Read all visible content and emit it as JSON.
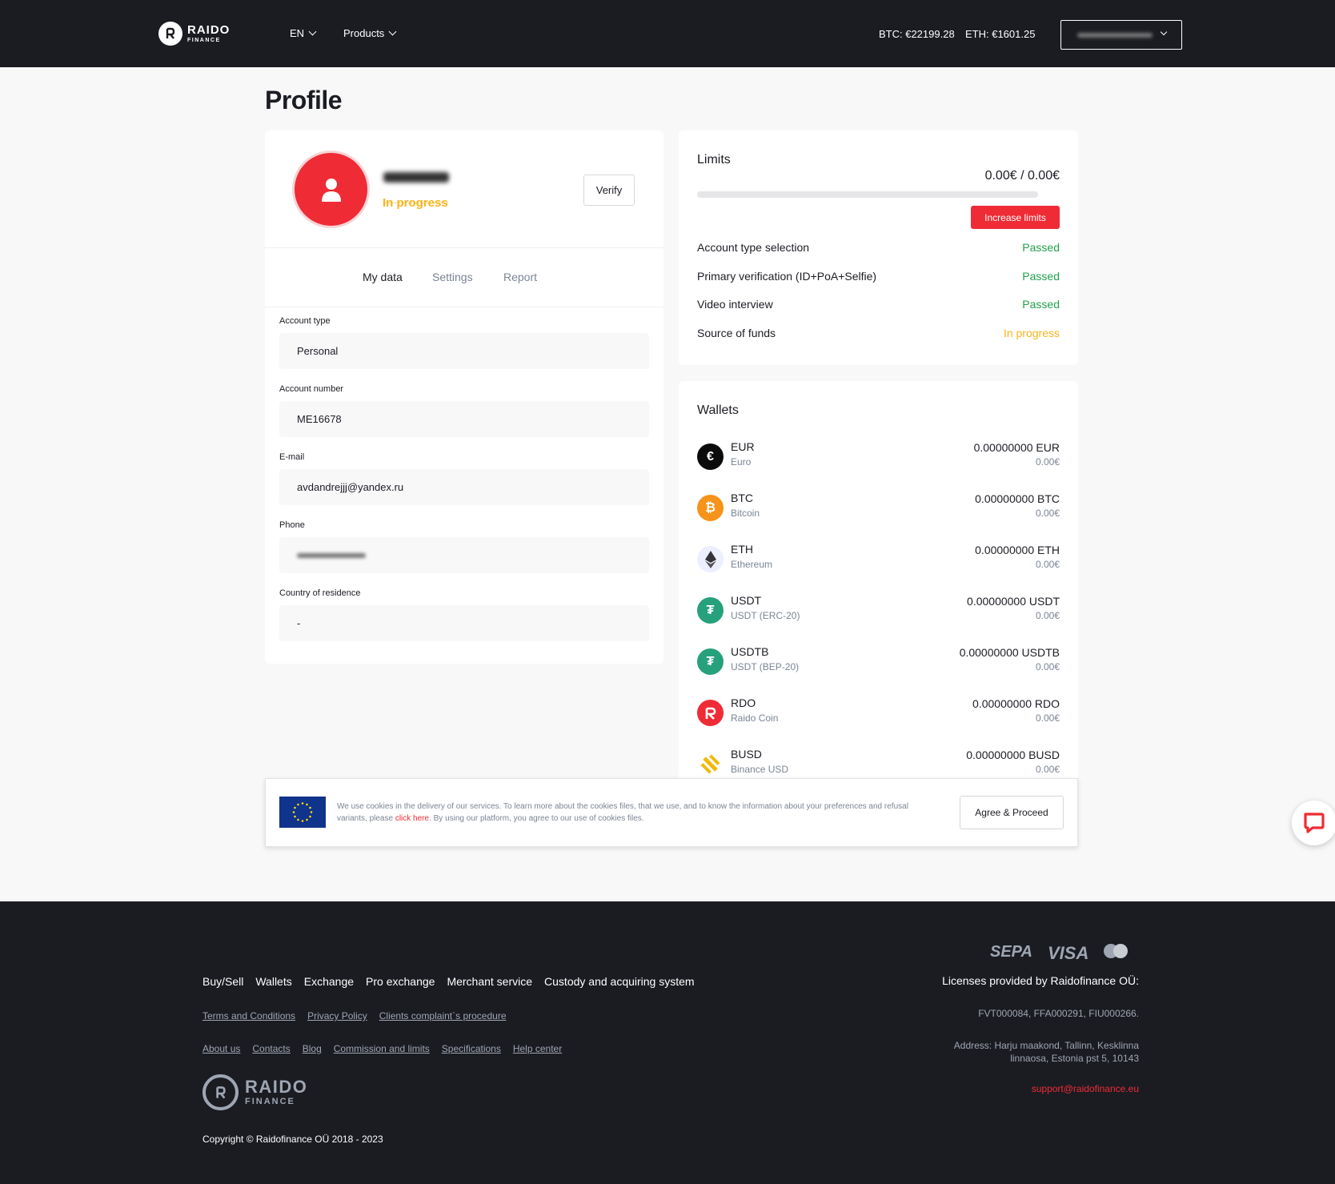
{
  "header": {
    "logo_main": "RAIDO",
    "logo_sub": "FINANCE",
    "lang": "EN",
    "products": "Products",
    "btc_rate": "BTC: €22199.28",
    "eth_rate": "ETH: €1601.25"
  },
  "page_title": "Profile",
  "profile": {
    "status": "In progress",
    "verify_label": "Verify",
    "tabs": [
      "My data",
      "Settings",
      "Report"
    ],
    "fields": [
      {
        "label": "Account type",
        "value": "Personal"
      },
      {
        "label": "Account number",
        "value": "ME16678"
      },
      {
        "label": "E-mail",
        "value": "avdandrejjj@yandex.ru"
      },
      {
        "label": "Phone",
        "value": ""
      },
      {
        "label": "Country of residence",
        "value": "-"
      }
    ]
  },
  "limits": {
    "title": "Limits",
    "amount": "0.00€ / 0.00€",
    "progress_fraction": 0,
    "increase_label": "Increase limits",
    "rows": [
      {
        "label": "Account type selection",
        "status": "Passed"
      },
      {
        "label": "Primary verification (ID+PoA+Selfie)",
        "status": "Passed"
      },
      {
        "label": "Video interview",
        "status": "Passed"
      },
      {
        "label": "Source of funds",
        "status": "In progress"
      }
    ]
  },
  "wallets": {
    "title": "Wallets",
    "items": [
      {
        "code": "EUR",
        "name": "Euro",
        "balance": "0.00000000 EUR",
        "eur": "0.00€",
        "color": "#0b0b0b",
        "icon": "euro-icon"
      },
      {
        "code": "BTC",
        "name": "Bitcoin",
        "balance": "0.00000000 BTC",
        "eur": "0.00€",
        "color": "#f7931a",
        "icon": "bitcoin-icon"
      },
      {
        "code": "ETH",
        "name": "Ethereum",
        "balance": "0.00000000 ETH",
        "eur": "0.00€",
        "color": "#ecefff",
        "icon": "ethereum-icon"
      },
      {
        "code": "USDT",
        "name": "USDT (ERC-20)",
        "balance": "0.00000000 USDT",
        "eur": "0.00€",
        "color": "#26a17b",
        "icon": "tether-icon"
      },
      {
        "code": "USDTB",
        "name": "USDT (BEP-20)",
        "balance": "0.00000000 USDTB",
        "eur": "0.00€",
        "color": "#26a17b",
        "icon": "tether-icon"
      },
      {
        "code": "RDO",
        "name": "Raido Coin",
        "balance": "0.00000000 RDO",
        "eur": "0.00€",
        "color": "#ef2b35",
        "icon": "raido-coin-icon"
      },
      {
        "code": "BUSD",
        "name": "Binance USD",
        "balance": "0.00000000 BUSD",
        "eur": "0.00€",
        "color": "#f0b90b",
        "icon": "binance-icon"
      }
    ]
  },
  "cookie": {
    "text_before": "We use cookies in the delivery of our services. To learn more about the cookies files, that we use, and to know the information about your preferences and refusal variants, please ",
    "link": "click here",
    "text_after": ". By using our platform, you agree to our use of cookies files.",
    "agree_label": "Agree & Proceed"
  },
  "footer": {
    "nav": [
      "Buy/Sell",
      "Wallets",
      "Exchange",
      "Pro exchange",
      "Merchant service",
      "Custody and acquiring system"
    ],
    "legal_links": [
      "Terms and Conditions",
      "Privacy Policy",
      "Clients complaint`s procedure"
    ],
    "info_links": [
      "About us",
      "Contacts",
      "Blog",
      "Commission and limits",
      "Specifications",
      "Help center"
    ],
    "logo_main": "RAIDO",
    "logo_sub": "FINANCE",
    "copyright": "Copyright © Raidofinance OÜ 2018 - 2023",
    "payments": [
      "SEPA",
      "VISA"
    ],
    "licenses_title": "Licenses provided by Raidofinance OÜ:",
    "licenses": "FVT000084, FFA000291, FIU000266.",
    "address_line1": "Address: Harju maakond, Tallinn, Kesklinna",
    "address_line2": "linnaosa, Estonia pst 5, 10143",
    "email": "support@raidofinance.eu"
  },
  "colors": {
    "accent": "#ef2b35",
    "passed": "#21a04a",
    "in_progress": "#f8b41e",
    "dark": "#1b1c22"
  }
}
